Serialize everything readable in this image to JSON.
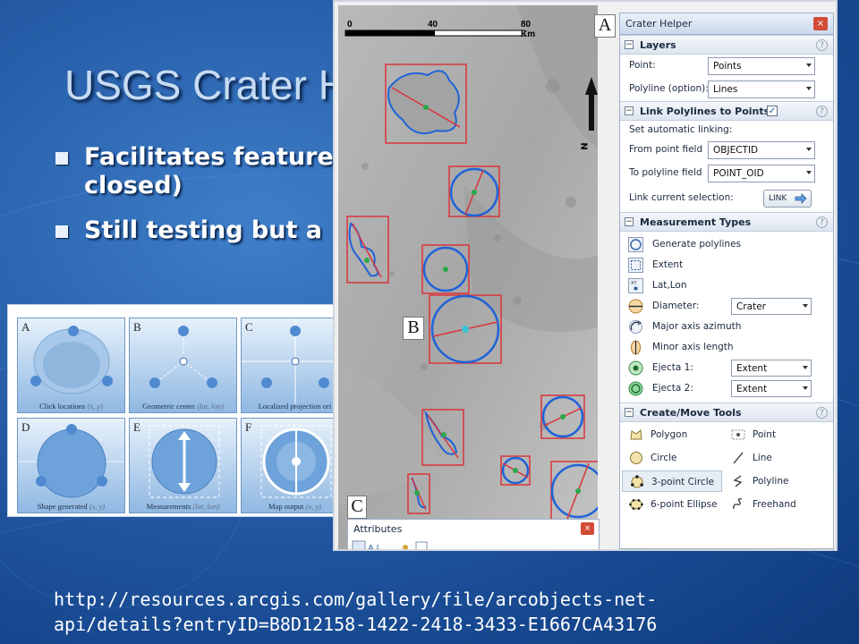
{
  "slide": {
    "title": "USGS Crater H",
    "bullets": [
      "Facilitates feature\nclosed)",
      "Still testing but a"
    ],
    "source_url": "http://resources.arcgis.com/gallery/file/arcobjects-net-\napi/details?entryID=B8D12158-1422-2418-3433-E1667CA43176"
  },
  "diagram": {
    "cells": [
      {
        "letter": "A",
        "caption": "Click locations",
        "coords": "(x, y)"
      },
      {
        "letter": "B",
        "caption": "Geometric center",
        "coords": "(lat, lon)"
      },
      {
        "letter": "C",
        "caption": "Localized projection ori",
        "coords": ""
      },
      {
        "letter": "D",
        "caption": "Shape generated",
        "coords": "(x, y)"
      },
      {
        "letter": "E",
        "caption": "Measurements",
        "coords": "(lat, lon)"
      },
      {
        "letter": "F",
        "caption": "Map output",
        "coords": "(x, y)"
      }
    ]
  },
  "map": {
    "scale": {
      "labels": [
        "0",
        "40",
        "80 Km"
      ]
    },
    "north_label": "N",
    "panel_letters": {
      "a": "A",
      "b": "B",
      "c": "C"
    }
  },
  "crater_helper": {
    "title": "Crater Helper",
    "close_glyph": "×",
    "help_glyph": "?",
    "layers": {
      "header": "Layers",
      "point_label": "Point:",
      "point_value": "Points",
      "polyline_label": "Polyline (option):",
      "polyline_value": "Lines"
    },
    "link": {
      "header": "Link Polylines to Points",
      "checked_glyph": "✓",
      "subtitle": "Set automatic linking:",
      "from_label": "From point field",
      "from_value": "OBJECTID",
      "to_label": "To polyline field",
      "to_value": "POINT_OID",
      "current_label": "Link current selection:",
      "button_label": "LINK"
    },
    "measurement": {
      "header": "Measurement Types",
      "items": [
        {
          "label": "Generate polylines",
          "icon": "generate-polylines-icon",
          "value": ""
        },
        {
          "label": "Extent",
          "icon": "extent-icon",
          "value": ""
        },
        {
          "label": "Lat,Lon",
          "icon": "latlon-icon",
          "value": ""
        },
        {
          "label": "Diameter:",
          "icon": "diameter-icon",
          "value": "Crater"
        },
        {
          "label": "Major axis azimuth",
          "icon": "major-axis-icon",
          "value": ""
        },
        {
          "label": "Minor axis length",
          "icon": "minor-axis-icon",
          "value": ""
        },
        {
          "label": "Ejecta 1:",
          "icon": "ejecta-1-icon",
          "value": "Extent"
        },
        {
          "label": "Ejecta 2:",
          "icon": "ejecta-2-icon",
          "value": "Extent"
        }
      ]
    },
    "tools": {
      "header": "Create/Move Tools",
      "items": [
        {
          "label": "Polygon",
          "icon": "polygon-icon"
        },
        {
          "label": "Point",
          "icon": "point-icon"
        },
        {
          "label": "Circle",
          "icon": "circle-icon"
        },
        {
          "label": "Line",
          "icon": "line-icon"
        },
        {
          "label": "3-point Circle",
          "icon": "three-point-circle-icon"
        },
        {
          "label": "Polyline",
          "icon": "polyline-icon"
        },
        {
          "label": "6-point Ellipse",
          "icon": "six-point-ellipse-icon"
        },
        {
          "label": "Freehand",
          "icon": "freehand-icon"
        }
      ],
      "selected": "3-point Circle"
    }
  },
  "attributes": {
    "title": "Attributes",
    "close_glyph": "×"
  },
  "colors": {
    "accent_blue": "#1f63d8",
    "box_red": "#d9343a",
    "point_green": "#2aa84a",
    "slide_blue": "#2a62ad"
  }
}
